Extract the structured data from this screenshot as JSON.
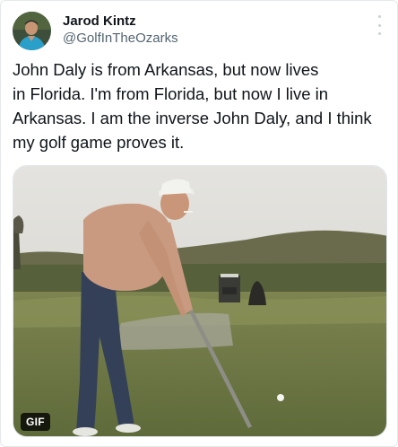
{
  "author": {
    "display_name": "Jarod Kintz",
    "handle": "@GolfInTheOzarks"
  },
  "tweet": {
    "text": "John Daly is from Arkansas, but now lives\nin Florida. I'm from Florida, but now I live in\nArkansas. I am the inverse John Daly, and I think\nmy golf game proves it."
  },
  "media": {
    "badge": "GIF"
  },
  "icons": {
    "more": "more-options-icon"
  }
}
